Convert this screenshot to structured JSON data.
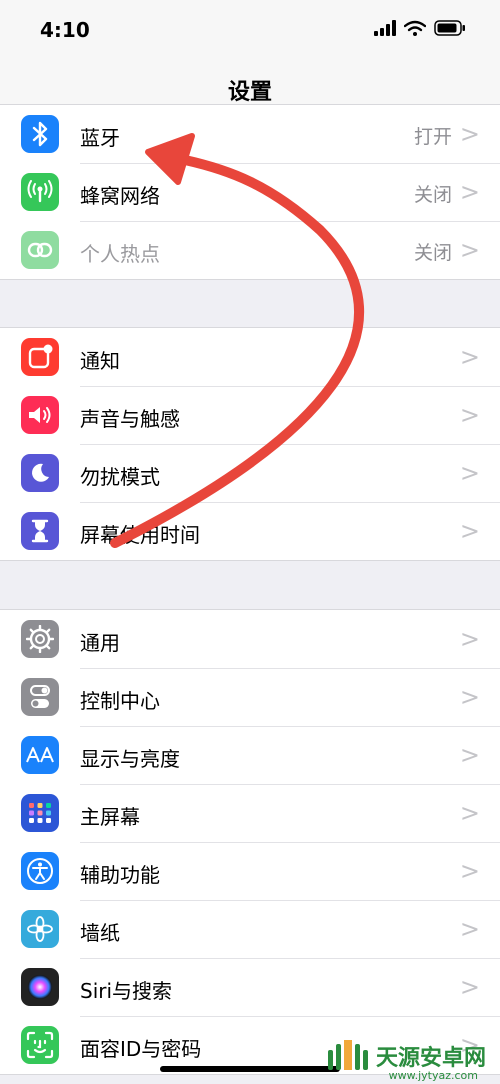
{
  "status": {
    "time": "4:10"
  },
  "nav": {
    "title": "设置"
  },
  "group1": [
    {
      "label": "蓝牙",
      "value": "打开",
      "icon": "bluetooth-icon",
      "color": "#1a82fb"
    },
    {
      "label": "蜂窝网络",
      "value": "关闭",
      "icon": "cellular-icon",
      "color": "#35c759"
    },
    {
      "label": "个人热点",
      "value": "关闭",
      "icon": "hotspot-icon",
      "color": "#8fdca0"
    }
  ],
  "group2": [
    {
      "label": "通知",
      "icon": "notifications-icon",
      "color": "#fe3b30"
    },
    {
      "label": "声音与触感",
      "icon": "sound-icon",
      "color": "#fe2d55"
    },
    {
      "label": "勿扰模式",
      "icon": "moon-icon",
      "color": "#5856d6"
    },
    {
      "label": "屏幕使用时间",
      "icon": "hourglass-icon",
      "color": "#5856d6"
    }
  ],
  "group3": [
    {
      "label": "通用",
      "icon": "gear-icon",
      "color": "#8e8e93"
    },
    {
      "label": "控制中心",
      "icon": "toggles-icon",
      "color": "#8e8e93"
    },
    {
      "label": "显示与亮度",
      "icon": "display-icon",
      "color": "#1a82fb"
    },
    {
      "label": "主屏幕",
      "icon": "home-screen-icon",
      "color": "#2c56d6"
    },
    {
      "label": "辅助功能",
      "icon": "accessibility-icon",
      "color": "#1a82fb"
    },
    {
      "label": "墙纸",
      "icon": "wallpaper-icon",
      "color": "#35aadc"
    },
    {
      "label": "Siri与搜索",
      "icon": "siri-icon",
      "color": "#222222"
    },
    {
      "label": "面容ID与密码",
      "icon": "face-id-icon",
      "color": "#35c759"
    }
  ],
  "chevron": ">",
  "watermark": {
    "text": "天源安卓网",
    "url": "www.jytyaz.com"
  }
}
